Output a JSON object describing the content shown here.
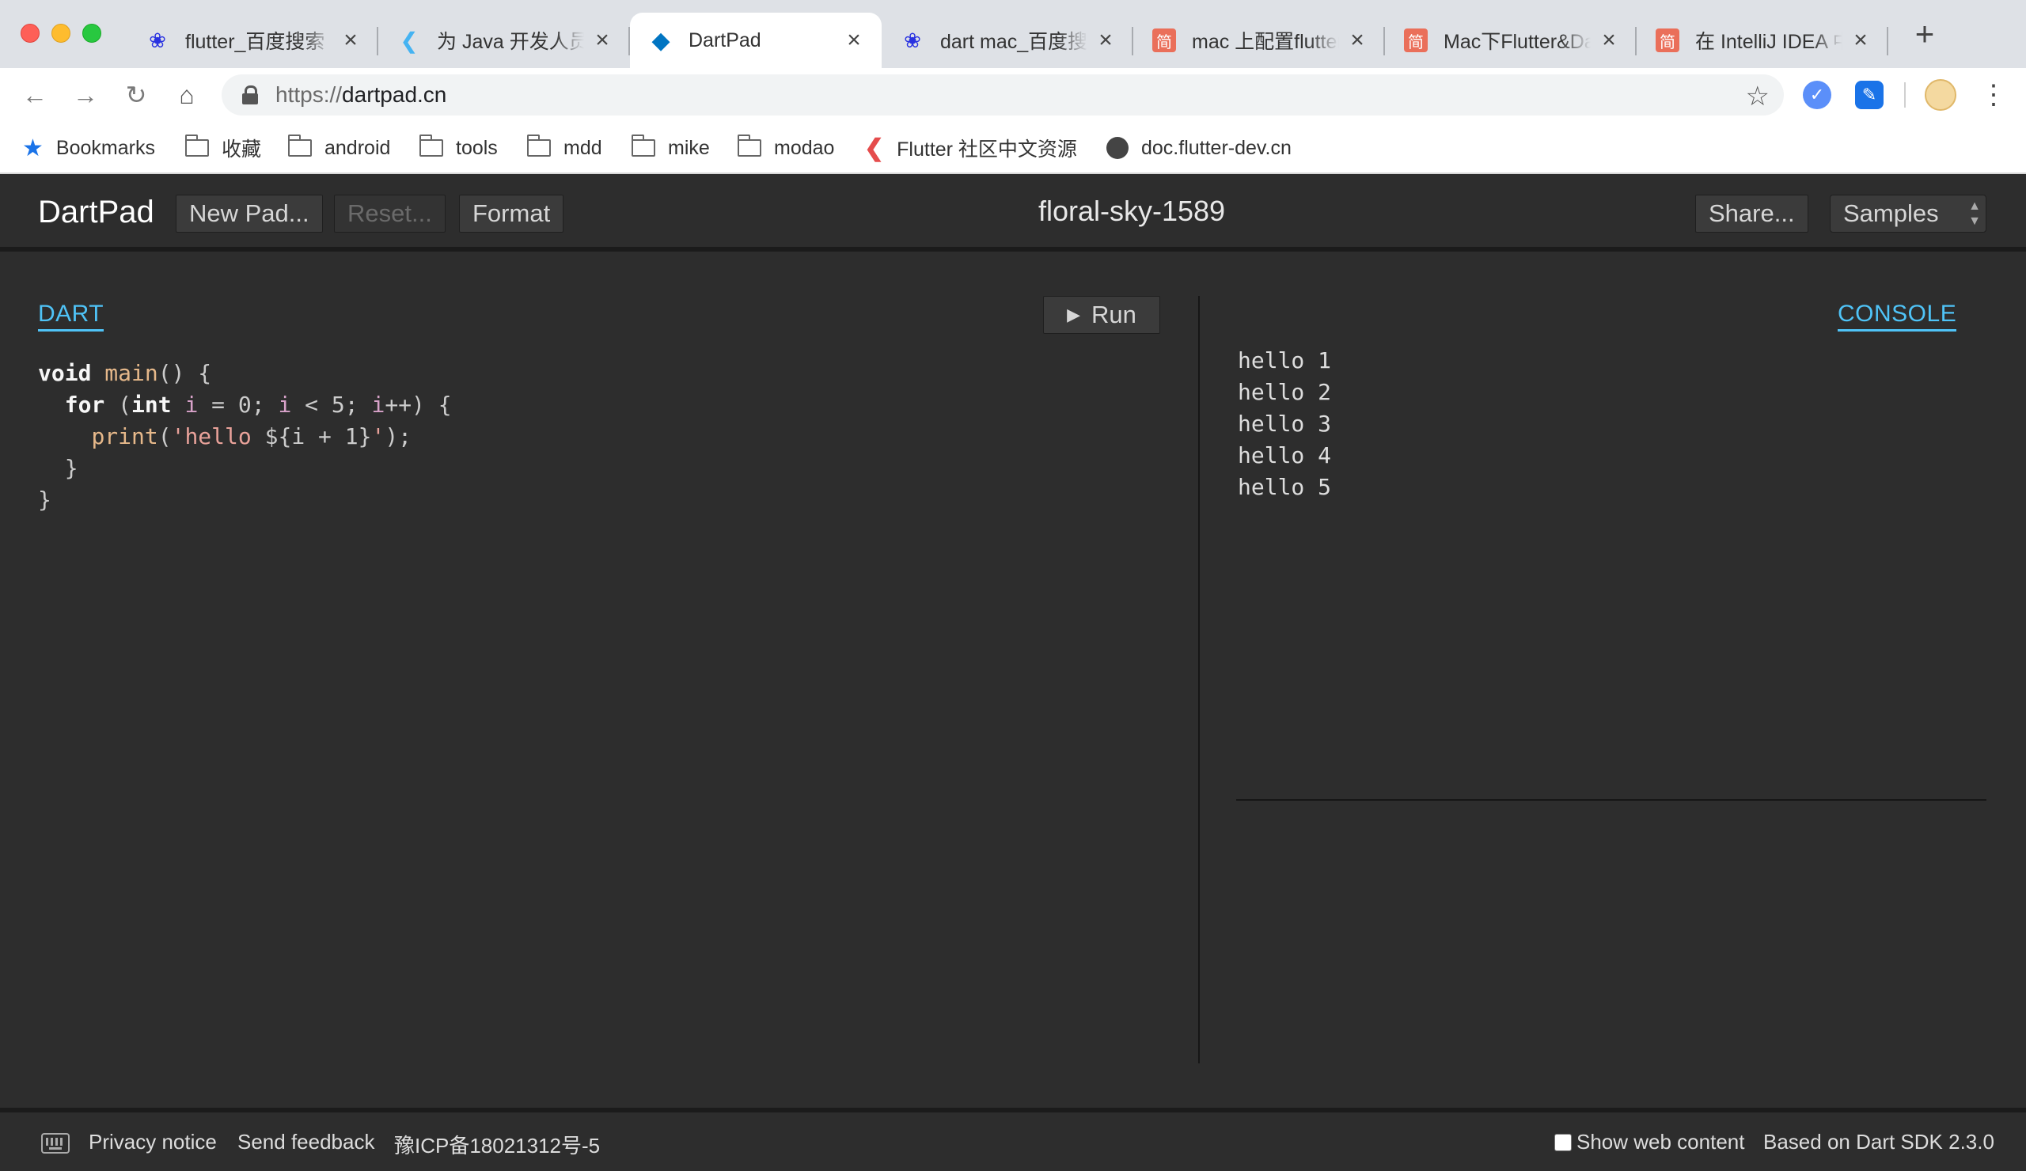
{
  "browser": {
    "tabs": [
      {
        "title": "flutter_百度搜索",
        "favicon": "baidu-paw-icon",
        "color": "#2932e1",
        "glyph": "🐾"
      },
      {
        "title": "为 Java 开发人员准备的",
        "favicon": "flutter-icon",
        "color": "#45b3f2",
        "glyph": "◤"
      },
      {
        "title": "DartPad",
        "favicon": "dart-icon",
        "color": "#0175c2",
        "glyph": "◆"
      },
      {
        "title": "dart mac_百度搜索",
        "favicon": "baidu-paw-icon",
        "color": "#2932e1",
        "glyph": "🐾"
      },
      {
        "title": "mac 上配置flutter",
        "favicon": "jianshu-icon",
        "color": "#ea6f5a",
        "glyph": "简"
      },
      {
        "title": "Mac下Flutter&Dart",
        "favicon": "jianshu-icon",
        "color": "#ea6f5a",
        "glyph": "简"
      },
      {
        "title": "在 IntelliJ IDEA 中",
        "favicon": "jianshu-icon",
        "color": "#ea6f5a",
        "glyph": "简"
      }
    ],
    "url_scheme": "https://",
    "url_host": "dartpad.cn",
    "bookmarks": [
      {
        "label": "Bookmarks",
        "icon": "star-icon"
      },
      {
        "label": "收藏",
        "icon": "folder-icon"
      },
      {
        "label": "android",
        "icon": "folder-icon"
      },
      {
        "label": "tools",
        "icon": "folder-icon"
      },
      {
        "label": "mdd",
        "icon": "folder-icon"
      },
      {
        "label": "mike",
        "icon": "folder-icon"
      },
      {
        "label": "modao",
        "icon": "folder-icon"
      },
      {
        "label": "Flutter 社区中文资源",
        "icon": "flutter-icon"
      },
      {
        "label": "doc.flutter-dev.cn",
        "icon": "globe-icon"
      }
    ]
  },
  "dartpad": {
    "brand": "DartPad",
    "buttons": {
      "new_pad": "New Pad...",
      "reset": "Reset...",
      "format": "Format",
      "share": "Share...",
      "samples": "Samples",
      "run": "Run"
    },
    "pad_title": "floral-sky-1589",
    "editor_label": "DART",
    "console_label": "CONSOLE",
    "code_lines": [
      "void main() {",
      "  for (int i = 0; i < 5; i++) {",
      "    print('hello ${i + 1}');",
      "  }",
      "}"
    ],
    "console_output": [
      "hello 1",
      "hello 2",
      "hello 3",
      "hello 4",
      "hello 5"
    ],
    "footer": {
      "privacy": "Privacy notice",
      "feedback": "Send feedback",
      "icp": "豫ICP备18021312号-5",
      "show_web": "Show web content",
      "sdk": "Based on Dart SDK 2.3.0"
    },
    "colors": {
      "accent": "#4fc3f7",
      "background": "#2d2d2d"
    }
  }
}
